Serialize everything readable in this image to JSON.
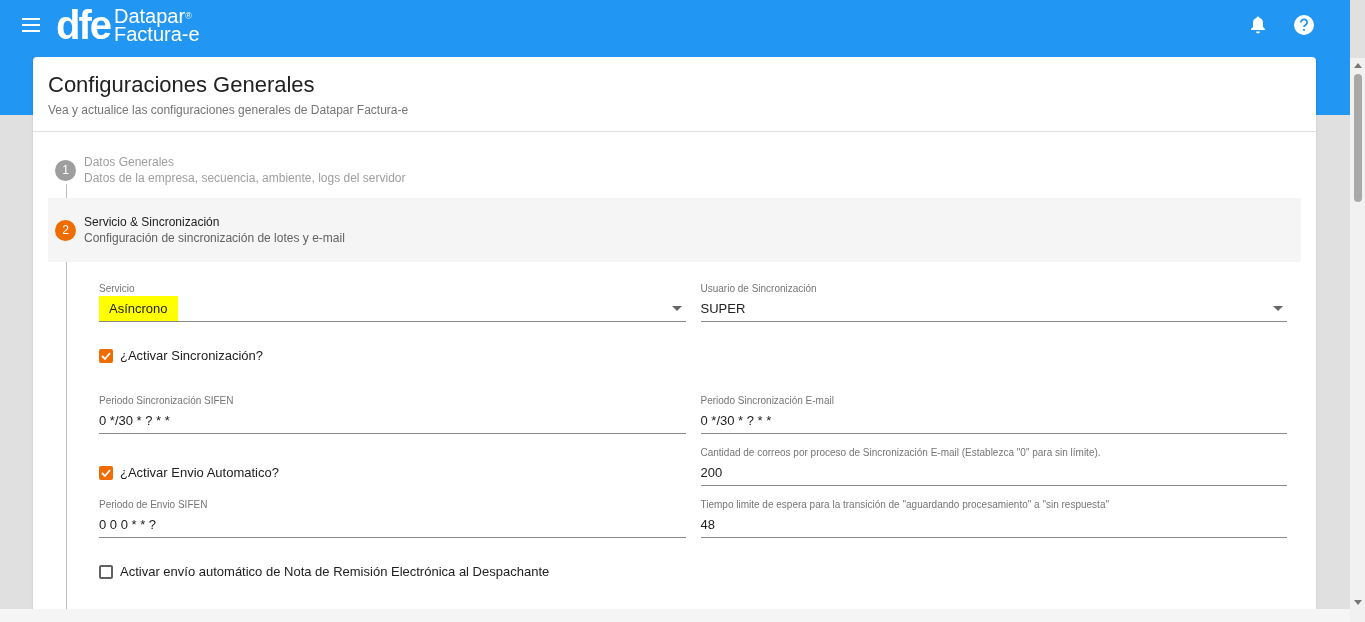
{
  "header": {
    "logo_mark": "dfe",
    "logo_line1": "Datapar",
    "logo_reg": "®",
    "logo_line2": "Factura-e"
  },
  "page": {
    "title": "Configuraciones Generales",
    "subtitle": "Vea y actualice las configuraciones generales de Datapar Factura-e"
  },
  "steps": [
    {
      "number": "1",
      "title": "Datos Generales",
      "subtitle": "Datos de la empresa, secuencia, ambiente, logs del servidor",
      "selected": false
    },
    {
      "number": "2",
      "title": "Servicio & Sincronización",
      "subtitle": "Configuración de sincronización de lotes y e-mail",
      "selected": true
    }
  ],
  "form_rows": [
    {
      "left": {
        "kind": "select",
        "label": "Servicio",
        "value": "Asíncrono",
        "highlighted": true
      },
      "right": {
        "kind": "select",
        "label": "Usuario de Sincronización",
        "value": "SUPER",
        "highlighted": false
      }
    },
    {
      "left": {
        "kind": "checkbox",
        "label": "¿Activar Sincronización?",
        "checked": true
      }
    },
    {
      "left": {
        "kind": "text",
        "label": "Periodo Sincronización SIFEN",
        "value": "0 */30 * ? * *"
      },
      "right": {
        "kind": "text",
        "label": "Periodo Sincronización E-mail",
        "value": "0 */30 * ? * *"
      }
    },
    {
      "left": {
        "kind": "checkbox",
        "label": "¿Activar Envio Automatico?",
        "checked": true
      },
      "right": {
        "kind": "text",
        "label": "Cantidad de correos por proceso de Sincronización E-mail (Establezca \"0\" para sin límite).",
        "value": "200"
      }
    },
    {
      "left": {
        "kind": "text",
        "label": "Periodo de Envio SIFEN",
        "value": "0 0 0 * * ?"
      },
      "right": {
        "kind": "text",
        "label": "Tiempo limite de espera para la transición de \"aguardando procesamiento\" a \"sin respuesta\"",
        "value": "48"
      }
    },
    {
      "left": {
        "kind": "checkbox",
        "label": "Activar envío automático de Nota de Remisión Electrónica al Despachante",
        "checked": false
      }
    }
  ]
}
